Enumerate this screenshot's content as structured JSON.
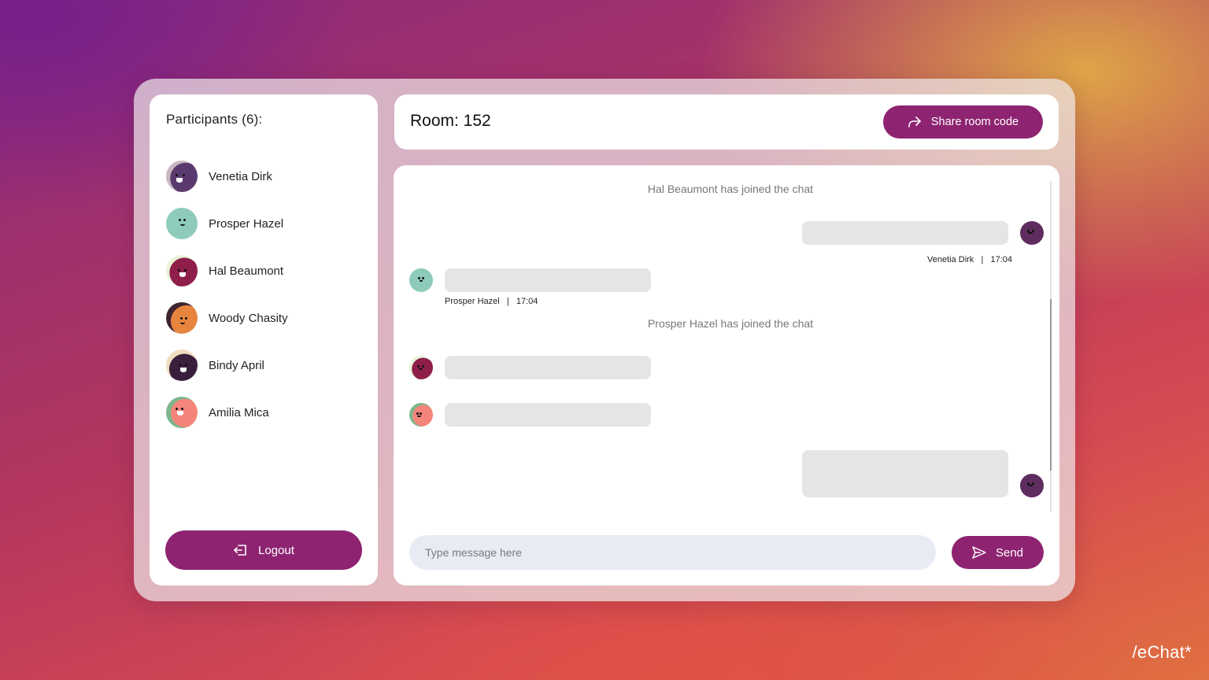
{
  "participants": {
    "title": "Participants (6):",
    "items": [
      {
        "name": "Venetia Dirk"
      },
      {
        "name": "Prosper Hazel"
      },
      {
        "name": "Hal Beaumont"
      },
      {
        "name": "Woody Chasity"
      },
      {
        "name": "Bindy April"
      },
      {
        "name": "Amilia Mica"
      }
    ],
    "logout_label": "Logout"
  },
  "header": {
    "room_title": "Room: 152",
    "share_label": "Share room code"
  },
  "chat": {
    "system_messages": [
      "Hal Beaumont has joined the chat",
      "Prosper Hazel has joined the chat"
    ],
    "meta": {
      "venetia": "Venetia Dirk   |   17:04",
      "prosper": "Prosper Hazel   |   17:04"
    },
    "input_placeholder": "Type message here",
    "send_label": "Send"
  },
  "brand": "/eChat*",
  "colors": {
    "accent": "#8e2471",
    "input_bg": "#e8ebf3",
    "bubble": "#e5e5e5"
  }
}
